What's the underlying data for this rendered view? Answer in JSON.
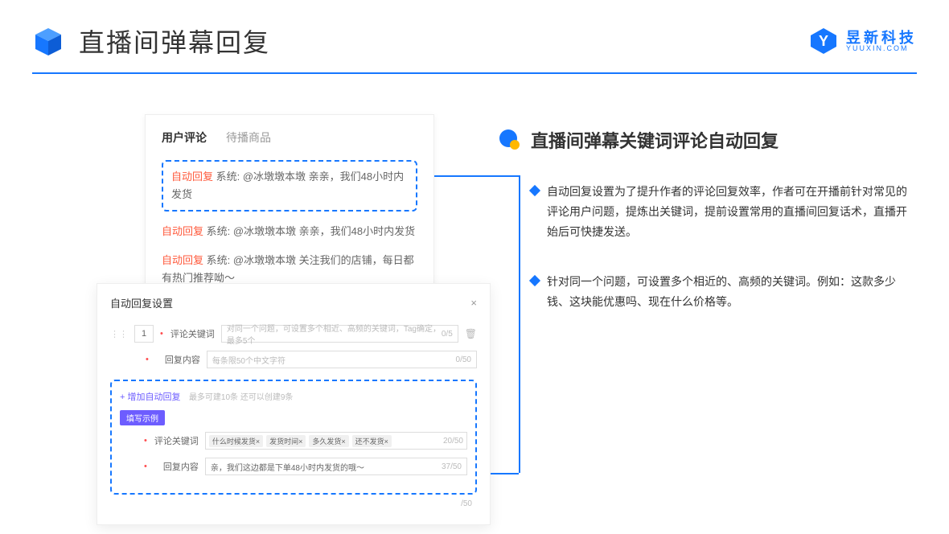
{
  "header": {
    "title": "直播间弹幕回复",
    "brand_name": "昱新科技",
    "brand_url": "YUUXIN.COM"
  },
  "comments": {
    "tab_active": "用户评论",
    "tab_inactive": "待播商品",
    "items": [
      {
        "tag": "自动回复",
        "text": "系统: @冰墩墩本墩 亲亲，我们48小时内发货"
      },
      {
        "tag": "自动回复",
        "text": "系统: @冰墩墩本墩 亲亲，我们48小时内发货"
      },
      {
        "tag": "自动回复",
        "text": "系统: @冰墩墩本墩 关注我们的店铺，每日都有热门推荐呦～"
      }
    ]
  },
  "settings": {
    "title": "自动回复设置",
    "row_num": "1",
    "keyword_label": "评论关键词",
    "keyword_placeholder": "对同一个问题，可设置多个相近、高频的关键词，Tag确定，最多5个",
    "keyword_counter": "0/5",
    "content_label": "回复内容",
    "content_placeholder": "每条限50个中文字符",
    "content_counter": "0/50",
    "add_text": "+ 增加自动回复",
    "add_hint": "最多可建10条 还可以创建9条",
    "example_badge": "填写示例",
    "example_kw_label": "评论关键词",
    "example_tags": [
      "什么时候发货×",
      "发货时间×",
      "多久发货×",
      "还不发货×"
    ],
    "example_kw_counter": "20/50",
    "example_content_label": "回复内容",
    "example_content_value": "亲，我们这边都是下单48小时内发货的哦～",
    "example_content_counter": "37/50",
    "outer_counter": "/50"
  },
  "right": {
    "section_title": "直播间弹幕关键词评论自动回复",
    "bullets": [
      "自动回复设置为了提升作者的评论回复效率，作者可在开播前针对常见的评论用户问题，提炼出关键词，提前设置常用的直播间回复话术，直播开始后可快捷发送。",
      "针对同一个问题，可设置多个相近的、高频的关键词。例如：这款多少钱、这块能优惠吗、现在什么价格等。"
    ]
  }
}
